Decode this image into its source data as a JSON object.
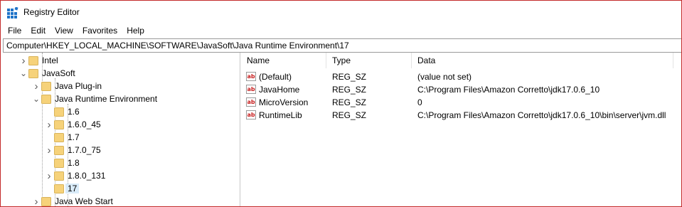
{
  "window": {
    "title": "Registry Editor"
  },
  "menu": [
    {
      "key": "F",
      "rest": "ile"
    },
    {
      "key": "E",
      "rest": "dit"
    },
    {
      "key": "V",
      "rest": "iew"
    },
    {
      "key": "",
      "pre": "F",
      "keymid": "a",
      "rest": "vorites"
    },
    {
      "key": "H",
      "rest": "elp"
    }
  ],
  "menu_labels": [
    "File",
    "Edit",
    "View",
    "Favorites",
    "Help"
  ],
  "address": "Computer\\HKEY_LOCAL_MACHINE\\SOFTWARE\\JavaSoft\\Java Runtime Environment\\17",
  "tree": {
    "items": [
      {
        "label": "Intel",
        "expandable": true,
        "expanded": false,
        "selected": false
      },
      {
        "label": "JavaSoft",
        "expandable": true,
        "expanded": true,
        "selected": false
      },
      {
        "label": "Java Plug-in",
        "expandable": true,
        "expanded": false,
        "selected": false
      },
      {
        "label": "Java Runtime Environment",
        "expandable": true,
        "expanded": true,
        "selected": false
      },
      {
        "label": "1.6",
        "expandable": false,
        "expanded": false,
        "selected": false
      },
      {
        "label": "1.6.0_45",
        "expandable": true,
        "expanded": false,
        "selected": false
      },
      {
        "label": "1.7",
        "expandable": false,
        "expanded": false,
        "selected": false
      },
      {
        "label": "1.7.0_75",
        "expandable": true,
        "expanded": false,
        "selected": false
      },
      {
        "label": "1.8",
        "expandable": false,
        "expanded": false,
        "selected": false
      },
      {
        "label": "1.8.0_131",
        "expandable": true,
        "expanded": false,
        "selected": false
      },
      {
        "label": "17",
        "expandable": false,
        "expanded": false,
        "selected": true
      },
      {
        "label": "Java Web Start",
        "expandable": true,
        "expanded": false,
        "selected": false
      }
    ]
  },
  "list": {
    "columns": [
      "Name",
      "Type",
      "Data"
    ],
    "rows": [
      {
        "name": "(Default)",
        "type": "REG_SZ",
        "data": "(value not set)",
        "icon": "string-value-icon"
      },
      {
        "name": "JavaHome",
        "type": "REG_SZ",
        "data": "C:\\Program Files\\Amazon Corretto\\jdk17.0.6_10",
        "icon": "string-value-icon"
      },
      {
        "name": "MicroVersion",
        "type": "REG_SZ",
        "data": "0",
        "icon": "string-value-icon"
      },
      {
        "name": "RuntimeLib",
        "type": "REG_SZ",
        "data": "C:\\Program Files\\Amazon Corretto\\jdk17.0.6_10\\bin\\server\\jvm.dll",
        "icon": "string-value-icon"
      }
    ]
  },
  "colors": {
    "window_border": "#c42b2b",
    "selection": "#d9ebf9",
    "folder": "#f6d27a",
    "icon_red": "#c81e1e"
  }
}
